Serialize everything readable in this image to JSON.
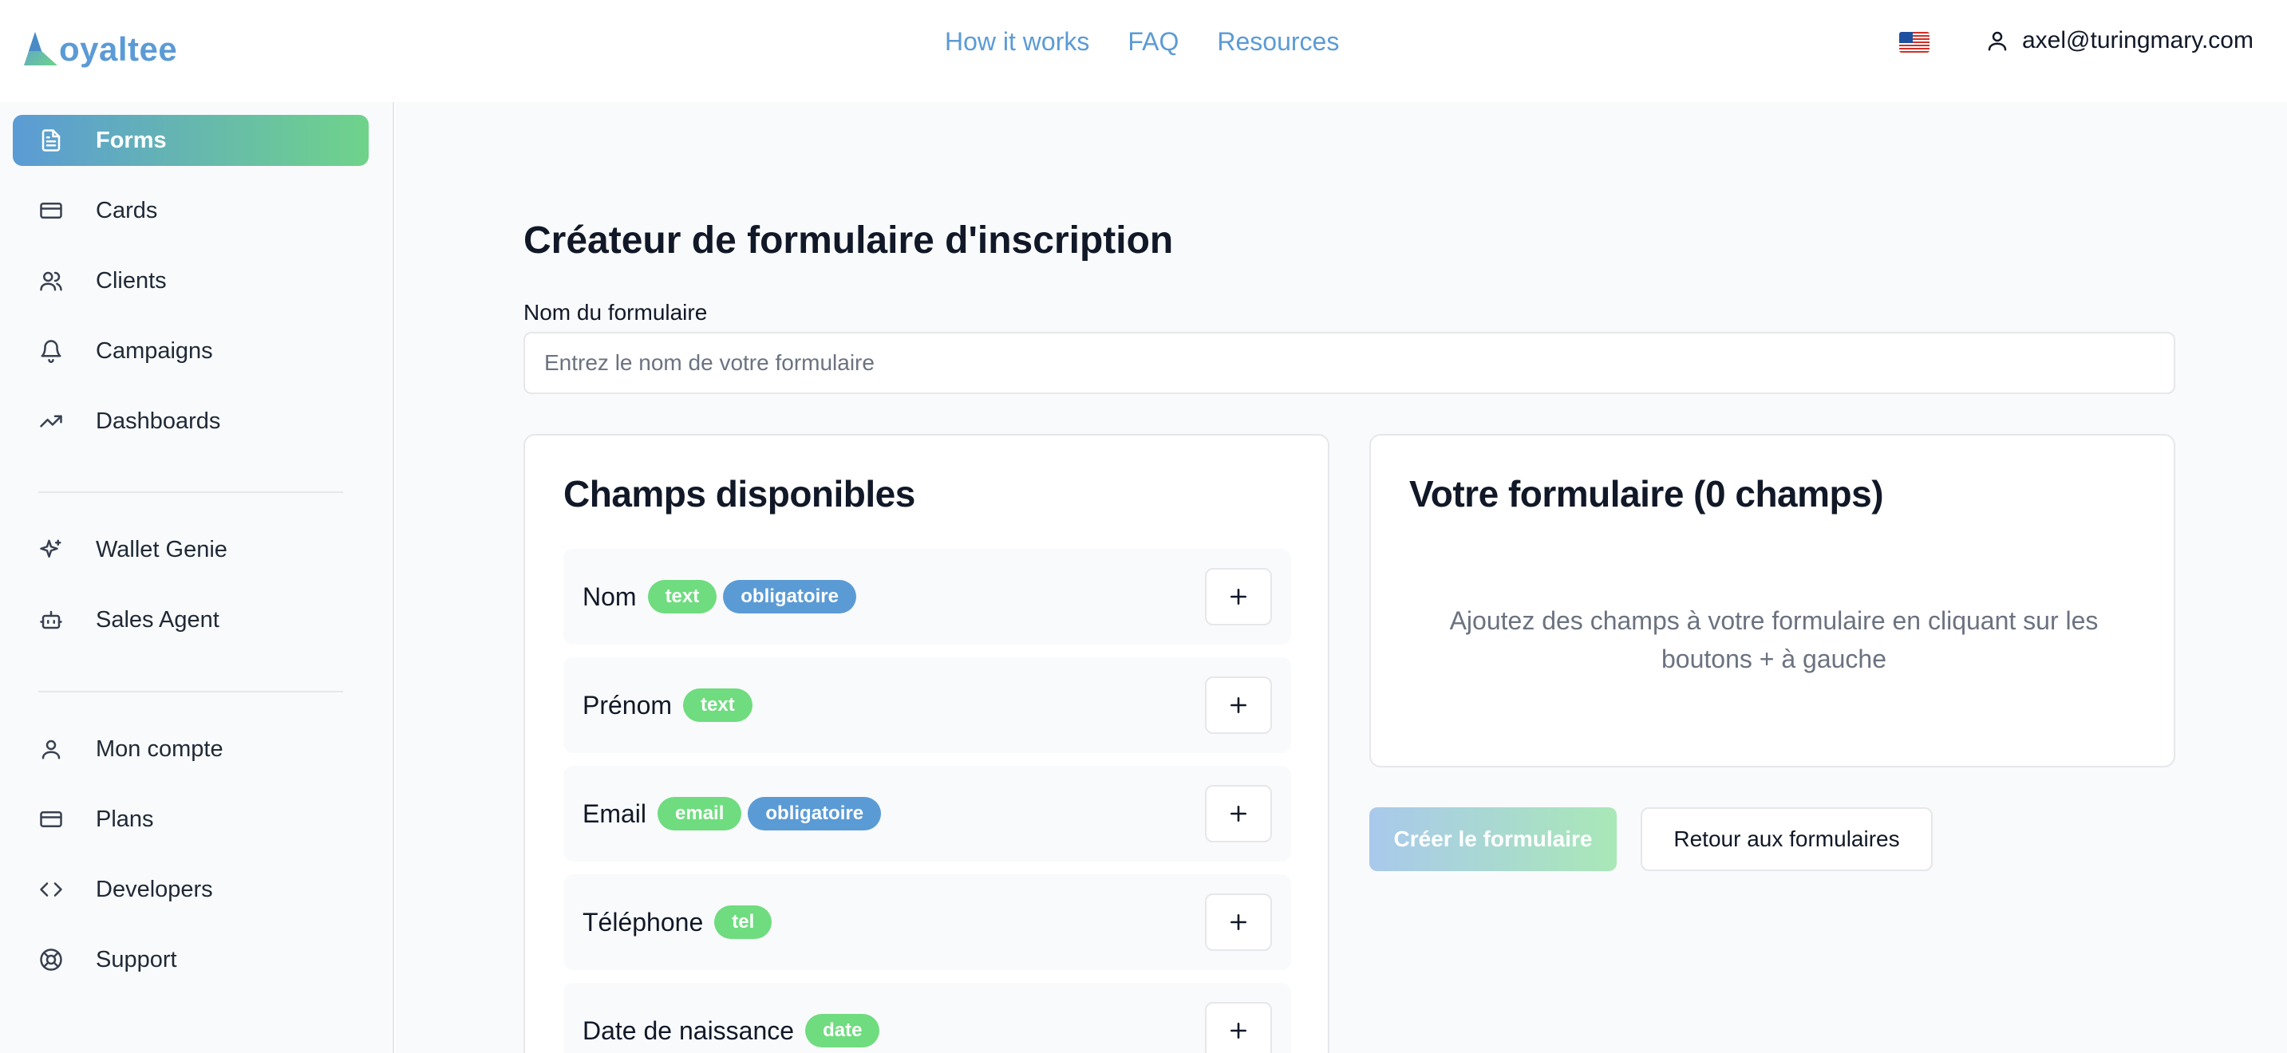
{
  "brand": {
    "logo_text": "oyaltee",
    "accent": "#5b9bd5",
    "accent2": "#6fd38a"
  },
  "topnav": [
    {
      "label": "How it works"
    },
    {
      "label": "FAQ"
    },
    {
      "label": "Resources"
    }
  ],
  "header": {
    "flag_icon": "us-flag-icon",
    "user_email": "axel@turingmary.com"
  },
  "sidebar": {
    "items": [
      {
        "label": "Forms",
        "icon": "document-icon",
        "active": true
      },
      {
        "label": "Cards",
        "icon": "card-icon"
      },
      {
        "label": "Clients",
        "icon": "users-icon"
      },
      {
        "label": "Campaigns",
        "icon": "bell-icon"
      },
      {
        "label": "Dashboards",
        "icon": "trending-up-icon"
      },
      {
        "label": "Wallet Genie",
        "icon": "sparkles-icon"
      },
      {
        "label": "Sales Agent",
        "icon": "bot-icon"
      },
      {
        "label": "Mon compte",
        "icon": "user-icon"
      },
      {
        "label": "Plans",
        "icon": "credit-card-icon"
      },
      {
        "label": "Developers",
        "icon": "code-icon"
      },
      {
        "label": "Support",
        "icon": "lifebuoy-icon"
      }
    ]
  },
  "main": {
    "title": "Créateur de formulaire d'inscription",
    "name_label": "Nom du formulaire",
    "name_placeholder": "Entrez le nom de votre formulaire",
    "name_value": "",
    "available": {
      "title": "Champs disponibles",
      "fields": [
        {
          "name": "Nom",
          "type": "text",
          "required": "obligatoire"
        },
        {
          "name": "Prénom",
          "type": "text"
        },
        {
          "name": "Email",
          "type": "email",
          "required": "obligatoire"
        },
        {
          "name": "Téléphone",
          "type": "tel"
        },
        {
          "name": "Date de naissance",
          "type": "date"
        }
      ]
    },
    "form": {
      "title": "Votre formulaire (0 champs)",
      "empty_message": "Ajoutez des champs à votre formulaire en cliquant sur les boutons + à gauche"
    },
    "actions": {
      "create_label": "Créer le formulaire",
      "back_label": "Retour aux formulaires"
    }
  }
}
